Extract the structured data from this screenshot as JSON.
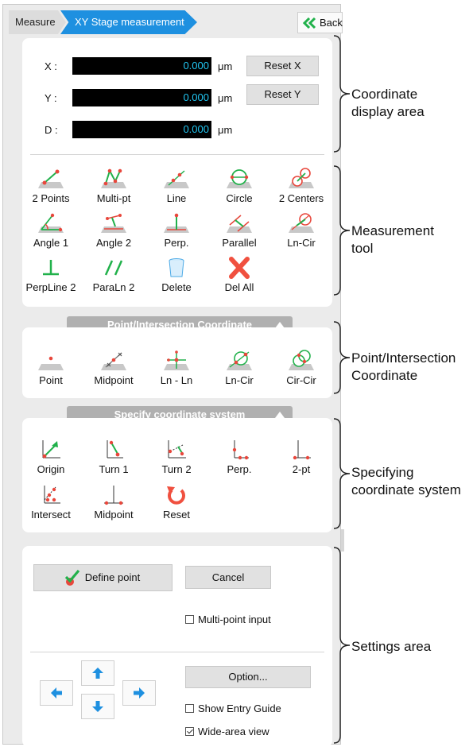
{
  "breadcrumb": {
    "root": "Measure",
    "current": "XY Stage measurement"
  },
  "back_label": "Back",
  "coordinates": {
    "x_label": "X :",
    "x_value": "0.000",
    "y_label": "Y :",
    "y_value": "0.000",
    "d_label": "D :",
    "d_value": "0.000",
    "unit": "μm",
    "reset_x": "Reset X",
    "reset_y": "Reset Y"
  },
  "measurement_tools": [
    {
      "label": "2 Points",
      "icon": "two-points-icon"
    },
    {
      "label": "Multi-pt",
      "icon": "multi-point-icon"
    },
    {
      "label": "Line",
      "icon": "line-icon"
    },
    {
      "label": "Circle",
      "icon": "circle-icon"
    },
    {
      "label": "2 Centers",
      "icon": "two-centers-icon"
    },
    {
      "label": "Angle 1",
      "icon": "angle-1-icon"
    },
    {
      "label": "Angle 2",
      "icon": "angle-2-icon"
    },
    {
      "label": "Perp.",
      "icon": "perpendicular-icon"
    },
    {
      "label": "Parallel",
      "icon": "parallel-icon"
    },
    {
      "label": "Ln-Cir",
      "icon": "line-circle-icon"
    },
    {
      "label": "PerpLine 2",
      "icon": "perp-line-icon"
    },
    {
      "label": "ParaLn 2",
      "icon": "parallel-line-icon"
    },
    {
      "label": "Delete",
      "icon": "trash-icon"
    },
    {
      "label": "Del All",
      "icon": "delete-all-icon"
    }
  ],
  "point_section": {
    "title": "Point/Intersection Coordinate",
    "tools": [
      {
        "label": "Point",
        "icon": "point-icon"
      },
      {
        "label": "Midpoint",
        "icon": "midpoint-icon"
      },
      {
        "label": "Ln - Ln",
        "icon": "line-line-icon"
      },
      {
        "label": "Ln-Cir",
        "icon": "line-circle-intersect-icon"
      },
      {
        "label": "Cir-Cir",
        "icon": "circle-circle-icon"
      }
    ]
  },
  "spec_section": {
    "title": "Specify coordinate system",
    "tools": [
      {
        "label": "Origin",
        "icon": "origin-icon"
      },
      {
        "label": "Turn 1",
        "icon": "turn-1-icon"
      },
      {
        "label": "Turn 2",
        "icon": "turn-2-icon"
      },
      {
        "label": "Perp.",
        "icon": "perp-axis-icon"
      },
      {
        "label": "2-pt",
        "icon": "two-point-axis-icon"
      },
      {
        "label": "Intersect",
        "icon": "intersect-axis-icon"
      },
      {
        "label": "Midpoint",
        "icon": "midpoint-axis-icon"
      },
      {
        "label": "Reset",
        "icon": "reset-icon"
      }
    ]
  },
  "settings": {
    "define_point": "Define point",
    "cancel": "Cancel",
    "multi_point_input": "Multi-point input",
    "multi_point_checked": false,
    "option": "Option...",
    "show_entry_guide": "Show Entry Guide",
    "show_entry_guide_checked": false,
    "wide_area_view": "Wide-area view",
    "wide_area_view_checked": true
  },
  "annotations": {
    "coordinate_display_line1": "Coordinate",
    "coordinate_display_line2": "display area",
    "measurement_tool_line1": "Measurement",
    "measurement_tool_line2": "tool",
    "point_intersection_line1": "Point/Intersection",
    "point_intersection_line2": "Coordinate",
    "specifying_line1": "Specifying",
    "specifying_line2": "coordinate system",
    "settings_area": "Settings area"
  },
  "colors": {
    "accent_blue": "#1e90e0",
    "readout_cyan": "#21c6f2",
    "marker_red": "#e8473c",
    "marker_green": "#21b14b"
  }
}
